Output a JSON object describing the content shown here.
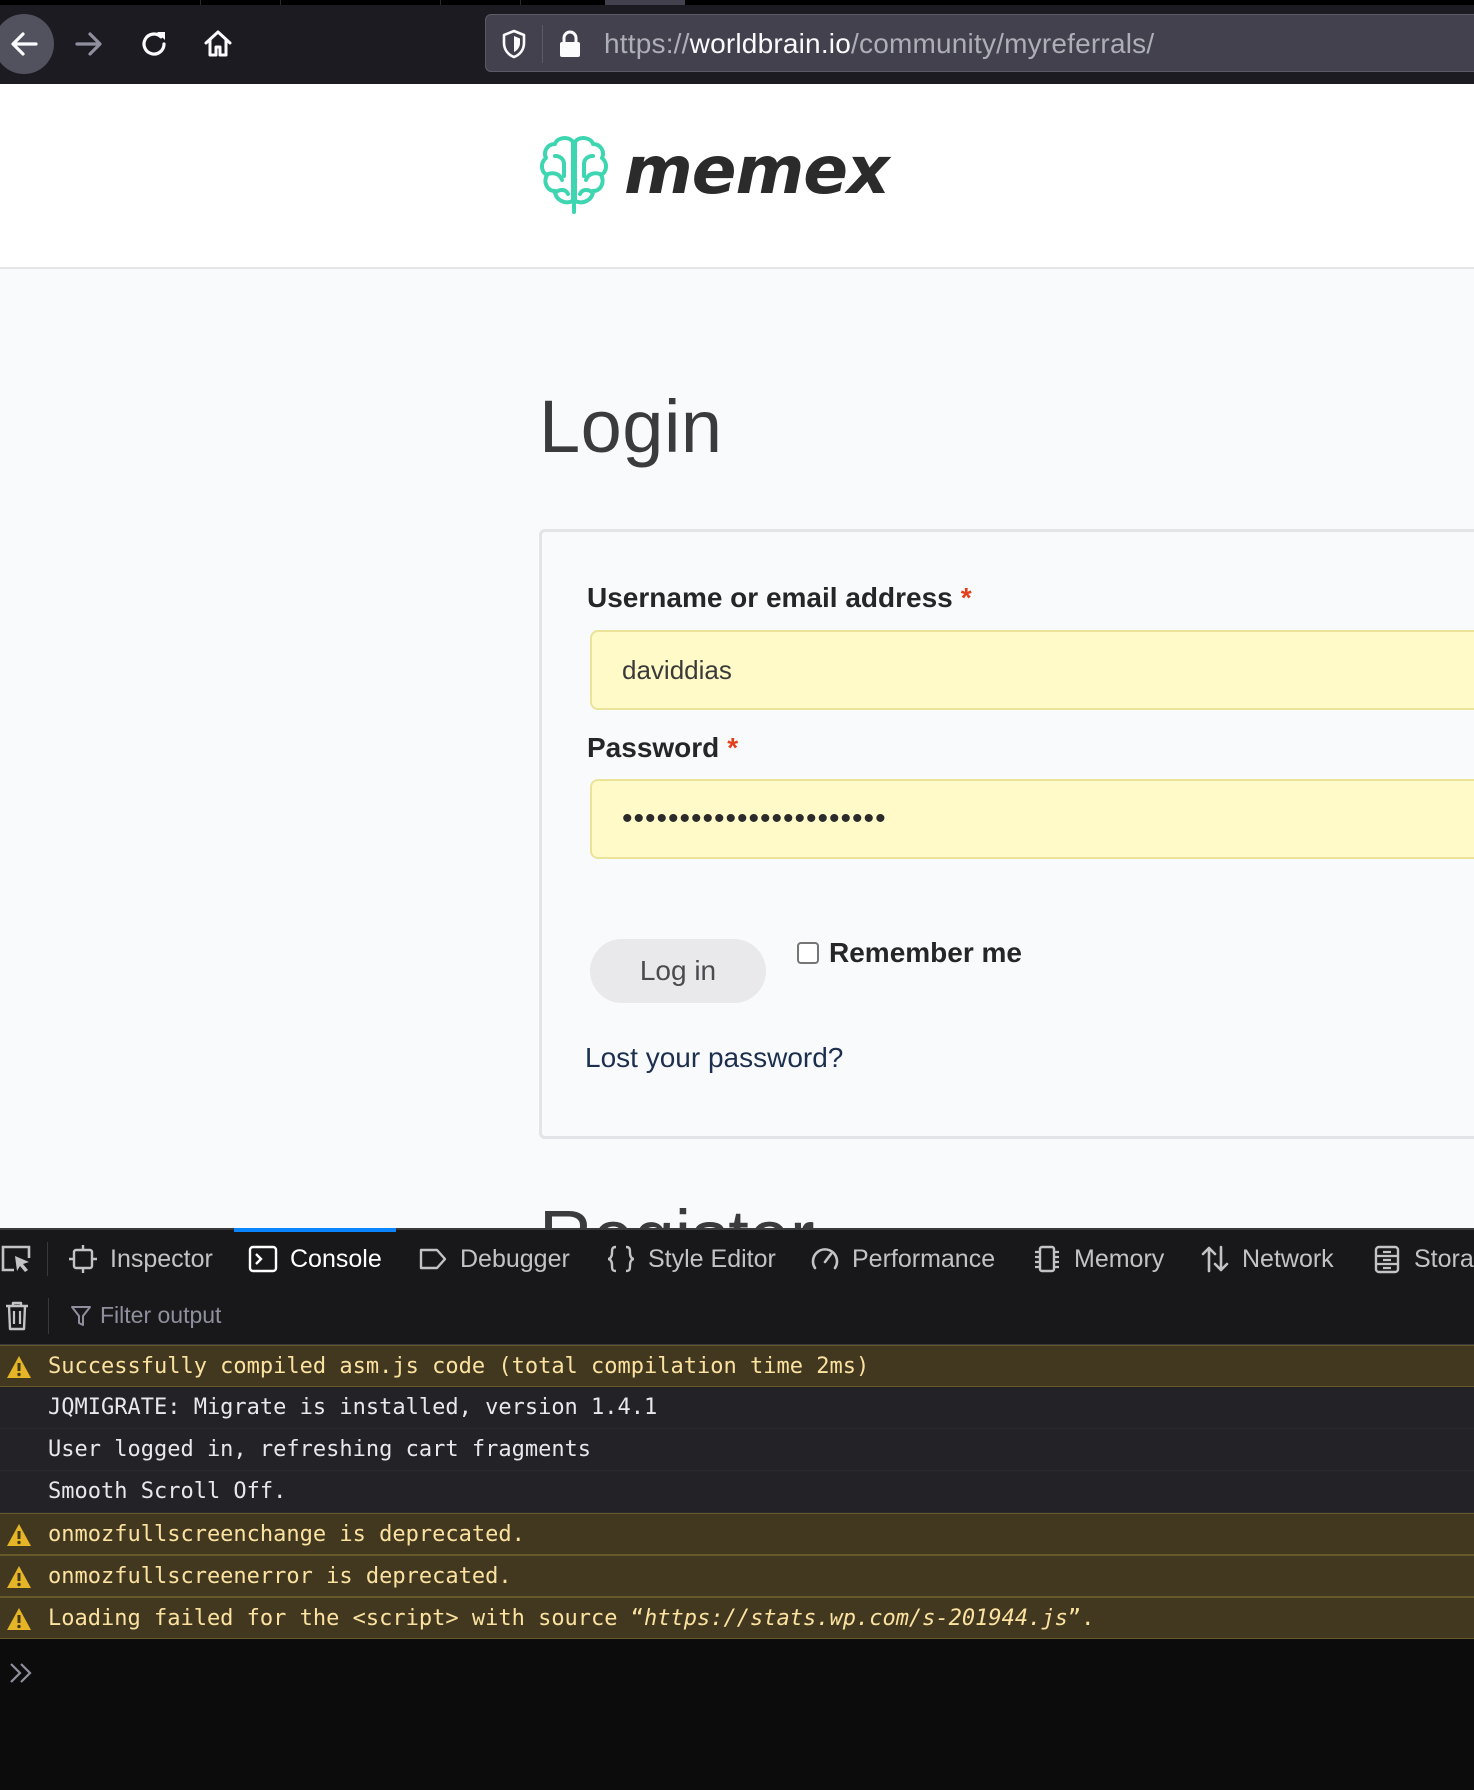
{
  "browser": {
    "url_scheme": "https://",
    "url_host": "worldbrain.io",
    "url_path": "/community/myreferrals/"
  },
  "site": {
    "logo_text": "memex",
    "accent_color": "#3ed6b0"
  },
  "login": {
    "title": "Login",
    "username_label": "Username or email address",
    "username_value": "daviddias",
    "password_label": "Password",
    "password_value": "•••••••••••••••••••••••",
    "required_mark": "*",
    "login_button": "Log in",
    "remember_label": "Remember me",
    "remember_checked": false,
    "lost_password": "Lost your password?",
    "next_section_peek": "Register"
  },
  "devtools": {
    "tabs": [
      {
        "label": "Inspector",
        "icon": "inspector-icon"
      },
      {
        "label": "Console",
        "icon": "console-icon",
        "selected": true
      },
      {
        "label": "Debugger",
        "icon": "debugger-icon"
      },
      {
        "label": "Style Editor",
        "icon": "braces-icon"
      },
      {
        "label": "Performance",
        "icon": "gauge-icon"
      },
      {
        "label": "Memory",
        "icon": "memory-chip-icon"
      },
      {
        "label": "Network",
        "icon": "network-arrows-icon"
      },
      {
        "label": "Stora",
        "icon": "storage-icon"
      }
    ],
    "filter_placeholder": "Filter output",
    "messages": [
      {
        "level": "warn",
        "text": "Successfully compiled asm.js code (total compilation time 2ms)"
      },
      {
        "level": "log",
        "text": "JQMIGRATE: Migrate is installed, version 1.4.1"
      },
      {
        "level": "log",
        "text": "User logged in, refreshing cart fragments"
      },
      {
        "level": "log",
        "text": "Smooth Scroll Off."
      },
      {
        "level": "warn",
        "text": "onmozfullscreenchange is deprecated."
      },
      {
        "level": "warn",
        "text": "onmozfullscreenerror is deprecated."
      },
      {
        "level": "warn",
        "text_prefix": "Loading failed for the <script> with source “",
        "text_url": "https://stats.wp.com/s-201944.js",
        "text_suffix": "”."
      }
    ]
  }
}
